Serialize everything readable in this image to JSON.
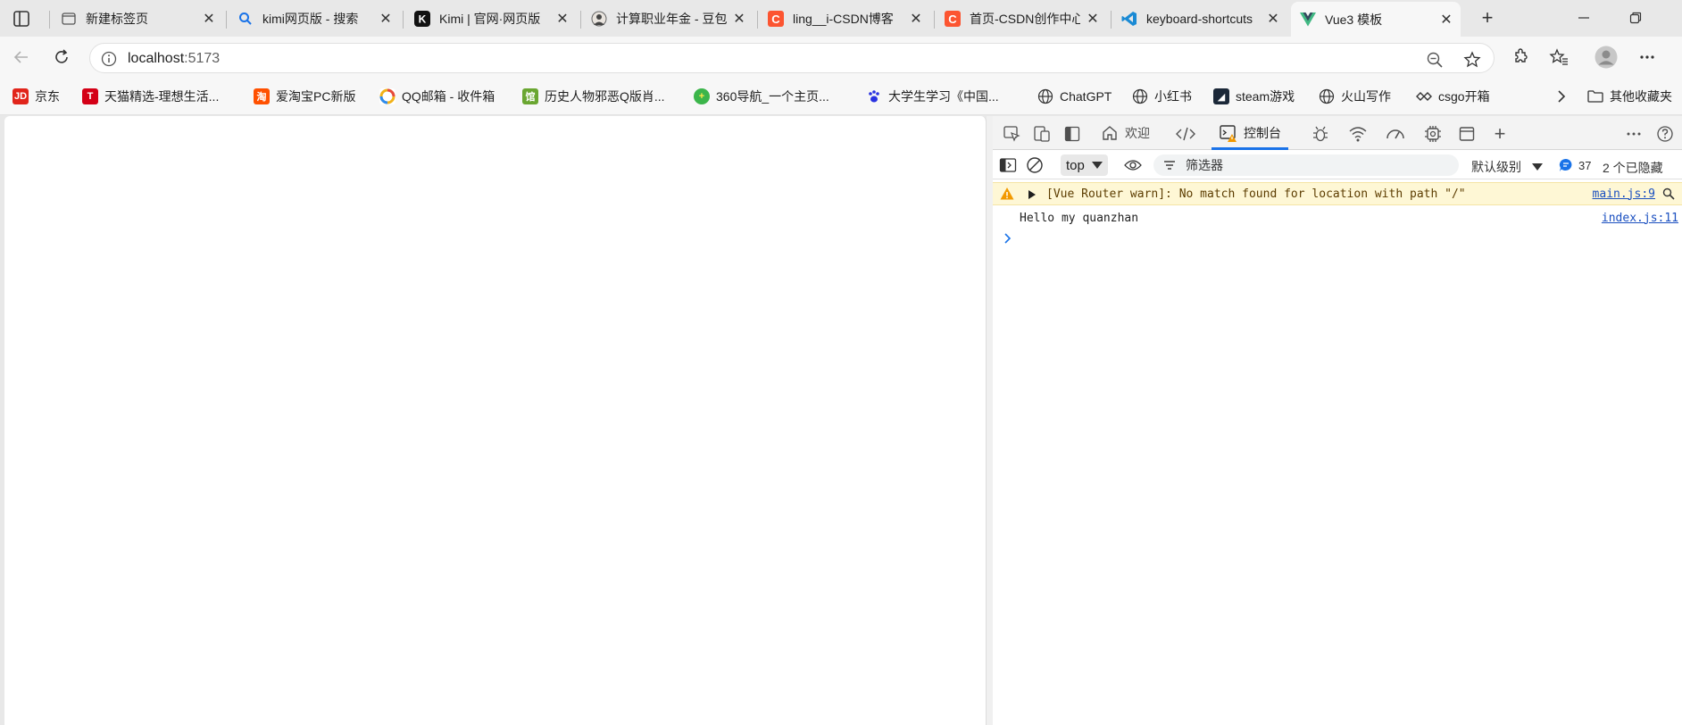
{
  "tabs": [
    {
      "title": "新建标签页",
      "icon": "new-tab-page-icon"
    },
    {
      "title": "kimi网页版 - 搜索",
      "icon": "search-icon"
    },
    {
      "title": "Kimi | 官网·网页版",
      "icon": "kimi-logo-icon"
    },
    {
      "title": "计算职业年金 - 豆包",
      "icon": "doubao-avatar-icon"
    },
    {
      "title": "ling__i-CSDN博客",
      "icon": "csdn-logo-icon"
    },
    {
      "title": "首页-CSDN创作中心",
      "icon": "csdn-logo-icon"
    },
    {
      "title": "keyboard-shortcuts",
      "icon": "vscode-icon"
    },
    {
      "title": "Vue3 模板",
      "icon": "vue-logo-icon",
      "active": true
    }
  ],
  "address": {
    "host": "localhost",
    "port": ":5173"
  },
  "bookmarks": [
    {
      "label": "京东",
      "badge": "JD",
      "color": "#e1251b"
    },
    {
      "label": "天猫精选-理想生活...",
      "badge": "T",
      "color": "#d40016"
    },
    {
      "label": "爱淘宝PC新版",
      "badge": "淘",
      "color": "#ff5000"
    },
    {
      "label": "QQ邮箱 - 收件箱",
      "badge": "Q",
      "color": "#2e8cf0"
    },
    {
      "label": "历史人物邪恶Q版肖...",
      "badge": "馆",
      "color": "#6aa631"
    },
    {
      "label": "360导航_一个主页...",
      "badge": "+",
      "color": "#3bb54a"
    },
    {
      "label": "大学生学习《中国...",
      "badge": "🐾",
      "color": "#2932e1"
    },
    {
      "label": "ChatGPT",
      "badge": "◎",
      "color": "#ffffff"
    },
    {
      "label": "小红书",
      "badge": "◎",
      "color": "#ffffff"
    },
    {
      "label": "steam游戏",
      "badge": "◆",
      "color": "#1b2838"
    },
    {
      "label": "火山写作",
      "badge": "◎",
      "color": "#ffffff"
    },
    {
      "label": "csgo开箱",
      "badge": "◈",
      "color": "#ffffff"
    }
  ],
  "other_bookmarks": "其他收藏夹",
  "devtools": {
    "welcome_tab": "欢迎",
    "console_tab": "控制台",
    "context": "top",
    "filter_placeholder": "筛选器",
    "level": "默认级别",
    "issues_count": "37",
    "hidden": "2 个已隐藏"
  },
  "console": {
    "warning": {
      "message": "[Vue Router warn]: No match found for location with path \"/\"",
      "source": "main.js:9"
    },
    "log": {
      "message": "Hello my quanzhan",
      "source": "index.js:11"
    }
  }
}
